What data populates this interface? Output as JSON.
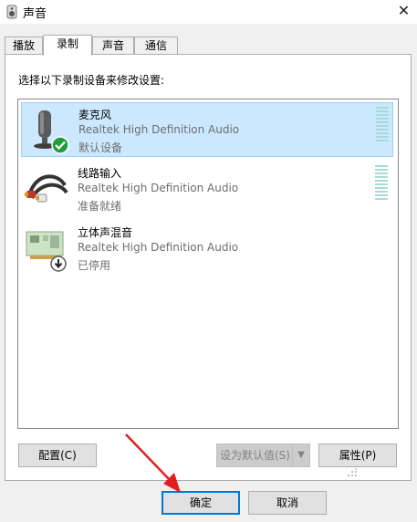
{
  "window": {
    "title": "声音",
    "close_glyph": "✕"
  },
  "tabs": [
    {
      "label": "播放",
      "active": false
    },
    {
      "label": "录制",
      "active": true
    },
    {
      "label": "声音",
      "active": false
    },
    {
      "label": "通信",
      "active": false
    }
  ],
  "panel": {
    "instruction": "选择以下录制设备来修改设置:"
  },
  "devices": [
    {
      "name": "麦克风",
      "driver": "Realtek High Definition Audio",
      "status": "默认设备",
      "icon": "microphone-icon",
      "badge": "default-check-badge",
      "selected": true
    },
    {
      "name": "线路输入",
      "driver": "Realtek High Definition Audio",
      "status": "准备就绪",
      "icon": "line-in-cable-icon",
      "selected": false
    },
    {
      "name": "立体声混音",
      "driver": "Realtek High Definition Audio",
      "status": "已停用",
      "icon": "sound-card-icon",
      "badge": "disabled-arrow-badge",
      "selected": false
    }
  ],
  "buttons": {
    "configure": "配置(C)",
    "set_default": "设为默认值(S)",
    "properties": "属性(P)",
    "ok": "确定",
    "cancel": "取消"
  },
  "colors": {
    "accent": "#0078d7",
    "selected_bg": "#cce8ff",
    "check_green": "#1e9e3a",
    "annotation_arrow": "#e02020"
  }
}
